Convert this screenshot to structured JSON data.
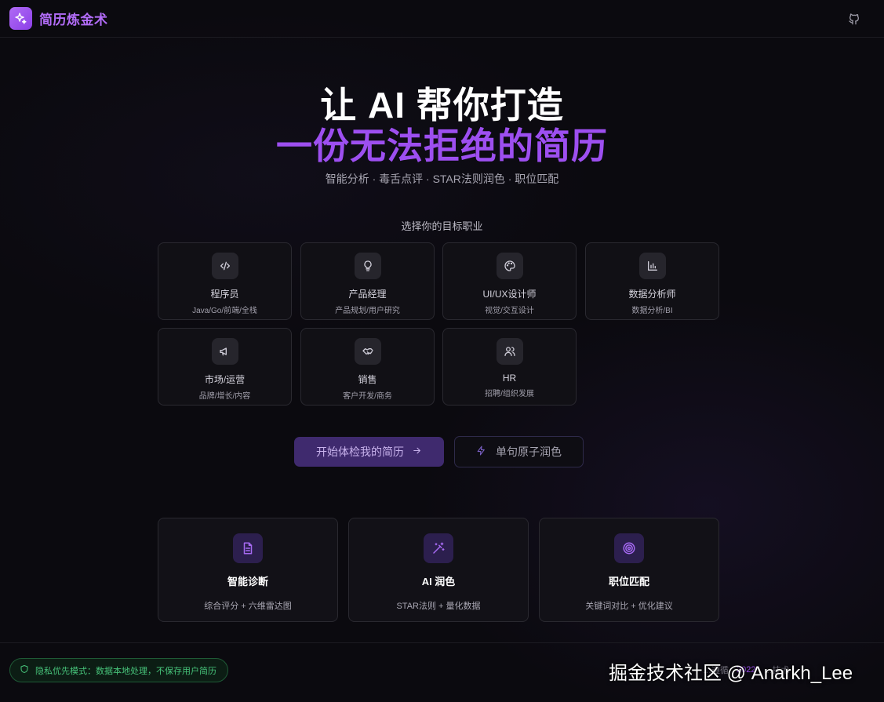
{
  "header": {
    "brand": "简历炼金术",
    "logo_icon": "sparkles-icon",
    "github_icon": "github-icon"
  },
  "hero": {
    "line1": "让 AI 帮你打造",
    "line2": "一份无法拒绝的简历",
    "subtitle": "智能分析 · 毒舌点评 · STAR法则润色 · 职位匹配",
    "select_label": "选择你的目标职业"
  },
  "roles": [
    {
      "title": "程序员",
      "sub": "Java/Go/前端/全栈",
      "icon": "code-icon"
    },
    {
      "title": "产品经理",
      "sub": "产品规划/用户研究",
      "icon": "lightbulb-icon"
    },
    {
      "title": "UI/UX设计师",
      "sub": "视觉/交互设计",
      "icon": "palette-icon"
    },
    {
      "title": "数据分析师",
      "sub": "数据分析/BI",
      "icon": "bar-chart-icon"
    },
    {
      "title": "市场/运营",
      "sub": "品牌/增长/内容",
      "icon": "megaphone-icon"
    },
    {
      "title": "销售",
      "sub": "客户开发/商务",
      "icon": "handshake-icon"
    },
    {
      "title": "HR",
      "sub": "招聘/组织发展",
      "icon": "users-icon"
    }
  ],
  "actions": {
    "primary": "开始体检我的简历",
    "primary_icon": "arrow-right-icon",
    "secondary": "单句原子润色",
    "secondary_icon": "zap-icon"
  },
  "features": [
    {
      "title": "智能诊断",
      "desc": "综合评分 + 六维雷达图",
      "icon": "file-text-icon"
    },
    {
      "title": "AI 润色",
      "desc": "STAR法则 + 量化数据",
      "icon": "magic-wand-icon"
    },
    {
      "title": "职位匹配",
      "desc": "关键词对比 + 优化建议",
      "icon": "target-icon"
    }
  ],
  "footer": {
    "privacy": "隐私优先模式：数据本地处理，不保存用户简历",
    "privacy_icon": "shield-icon",
    "link_a": "…遵循",
    "link_year": "2022",
    "link_b": "…技术"
  },
  "watermark": "掘金技术社区 @ Anarkh_Lee",
  "colors": {
    "accent": "#9d4ff0",
    "brand": "#b26cf7",
    "background": "#0b0a0f",
    "privacy_green": "#47c47a"
  }
}
